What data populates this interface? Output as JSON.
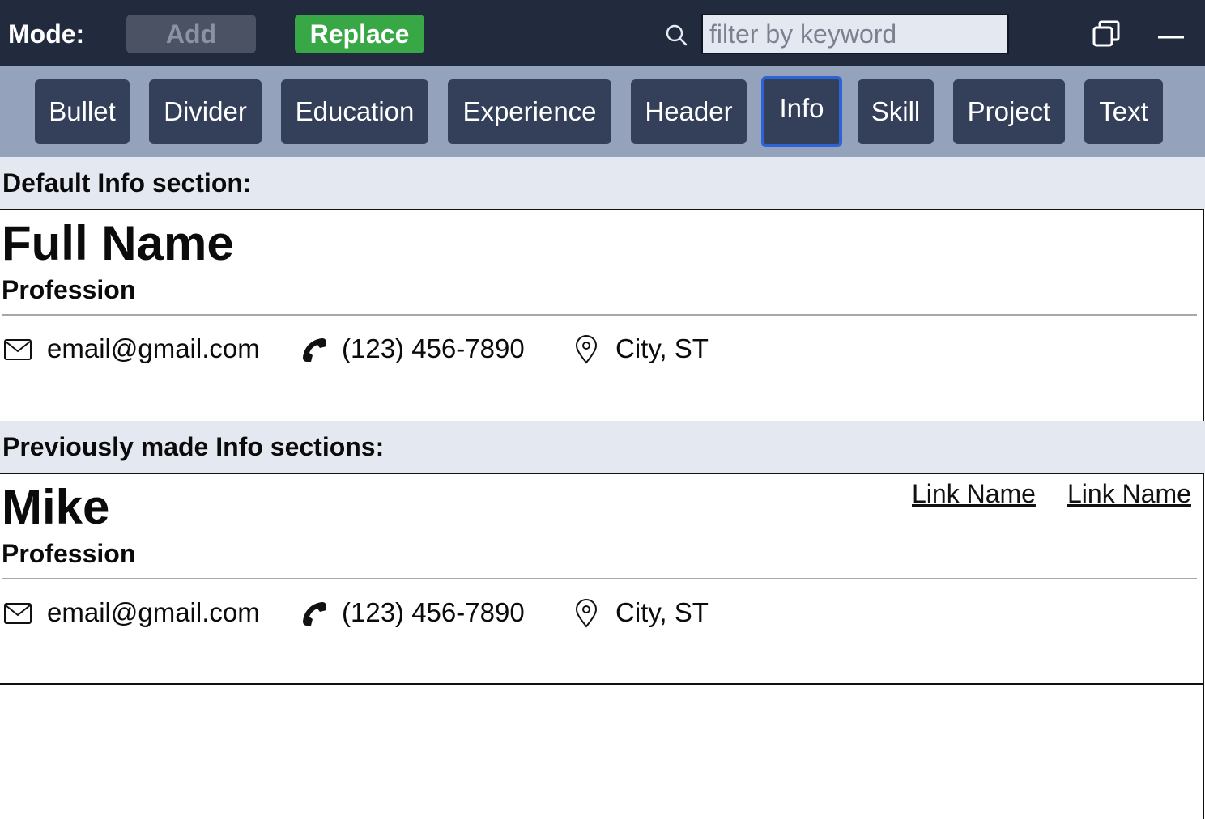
{
  "topbar": {
    "mode_label": "Mode:",
    "add_label": "Add",
    "replace_label": "Replace",
    "search_placeholder": "filter by keyword",
    "colors": {
      "bar": "#222a3e",
      "replace": "#38a847",
      "add_disabled": "#4a5263"
    }
  },
  "section_types": [
    {
      "label": "Bullet"
    },
    {
      "label": "Divider"
    },
    {
      "label": "Education"
    },
    {
      "label": "Experience"
    },
    {
      "label": "Header"
    },
    {
      "label": "Info",
      "selected": true
    },
    {
      "label": "Skill"
    },
    {
      "label": "Project"
    },
    {
      "label": "Text"
    }
  ],
  "default_section": {
    "heading": "Default Info section:",
    "name": "Full Name",
    "profession": "Profession",
    "email": "email@gmail.com",
    "phone": "(123) 456-7890",
    "location": "City, ST"
  },
  "previous_sections": {
    "heading": "Previously made Info sections:",
    "items": [
      {
        "name": "Mike",
        "profession": "Profession",
        "email": "email@gmail.com",
        "phone": "(123) 456-7890",
        "location": "City, ST",
        "links": [
          "Link Name",
          "Link Name"
        ]
      }
    ]
  },
  "icons": {
    "search": "search-icon",
    "restore": "restore-window-icon",
    "minimize": "minimize-icon",
    "email": "envelope-icon",
    "phone": "phone-icon",
    "location": "map-pin-icon"
  }
}
